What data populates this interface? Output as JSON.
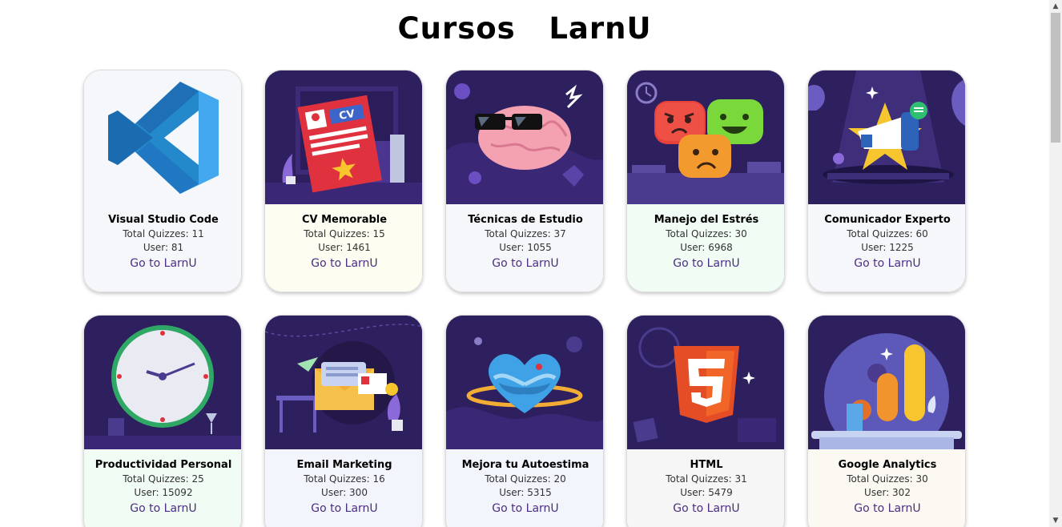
{
  "page": {
    "title": "Cursos   LarnU"
  },
  "colors": {
    "link": "#4b2e83",
    "illustration_background": "#2e1f5e"
  },
  "courses": [
    {
      "title": "Visual Studio Code",
      "quizzes": "Total Quizzes: 11",
      "users": "User: 81",
      "link": "Go to LarnU",
      "icon": "vscode-logo-icon",
      "body_color": "#f6f7fb"
    },
    {
      "title": "CV Memorable",
      "quizzes": "Total Quizzes: 15",
      "users": "User: 1461",
      "link": "Go to LarnU",
      "icon": "cv-document-icon",
      "body_color": "#fdfdf1"
    },
    {
      "title": "Técnicas de Estudio",
      "quizzes": "Total Quizzes: 37",
      "users": "User: 1055",
      "link": "Go to LarnU",
      "icon": "brain-glasses-icon",
      "body_color": "#f6f7fb"
    },
    {
      "title": "Manejo del Estrés",
      "quizzes": "Total Quizzes: 30",
      "users": "User: 6968",
      "link": "Go to LarnU",
      "icon": "emotion-faces-icon",
      "body_color": "#f1fcf4"
    },
    {
      "title": "Comunicador Experto",
      "quizzes": "Total Quizzes: 60",
      "users": "User: 1225",
      "link": "Go to LarnU",
      "icon": "megaphone-star-icon",
      "body_color": "#f6f7fb"
    },
    {
      "title": "Productividad Personal",
      "quizzes": "Total Quizzes: 25",
      "users": "User: 15092",
      "link": "Go to LarnU",
      "icon": "clock-icon",
      "body_color": "#f1fcf4"
    },
    {
      "title": "Email Marketing",
      "quizzes": "Total Quizzes: 16",
      "users": "User: 300",
      "link": "Go to LarnU",
      "icon": "envelope-icon",
      "body_color": "#f3f5fc"
    },
    {
      "title": "Mejora tu Autoestima",
      "quizzes": "Total Quizzes: 20",
      "users": "User: 5315",
      "link": "Go to LarnU",
      "icon": "heart-hug-icon",
      "body_color": "#f3f5fc"
    },
    {
      "title": "HTML",
      "quizzes": "Total Quizzes: 31",
      "users": "User: 5479",
      "link": "Go to LarnU",
      "icon": "html5-logo-icon",
      "body_color": "#f6f6f6"
    },
    {
      "title": "Google Analytics",
      "quizzes": "Total Quizzes: 30",
      "users": "User: 302",
      "link": "Go to LarnU",
      "icon": "analytics-bars-icon",
      "body_color": "#fcf8f2"
    }
  ]
}
